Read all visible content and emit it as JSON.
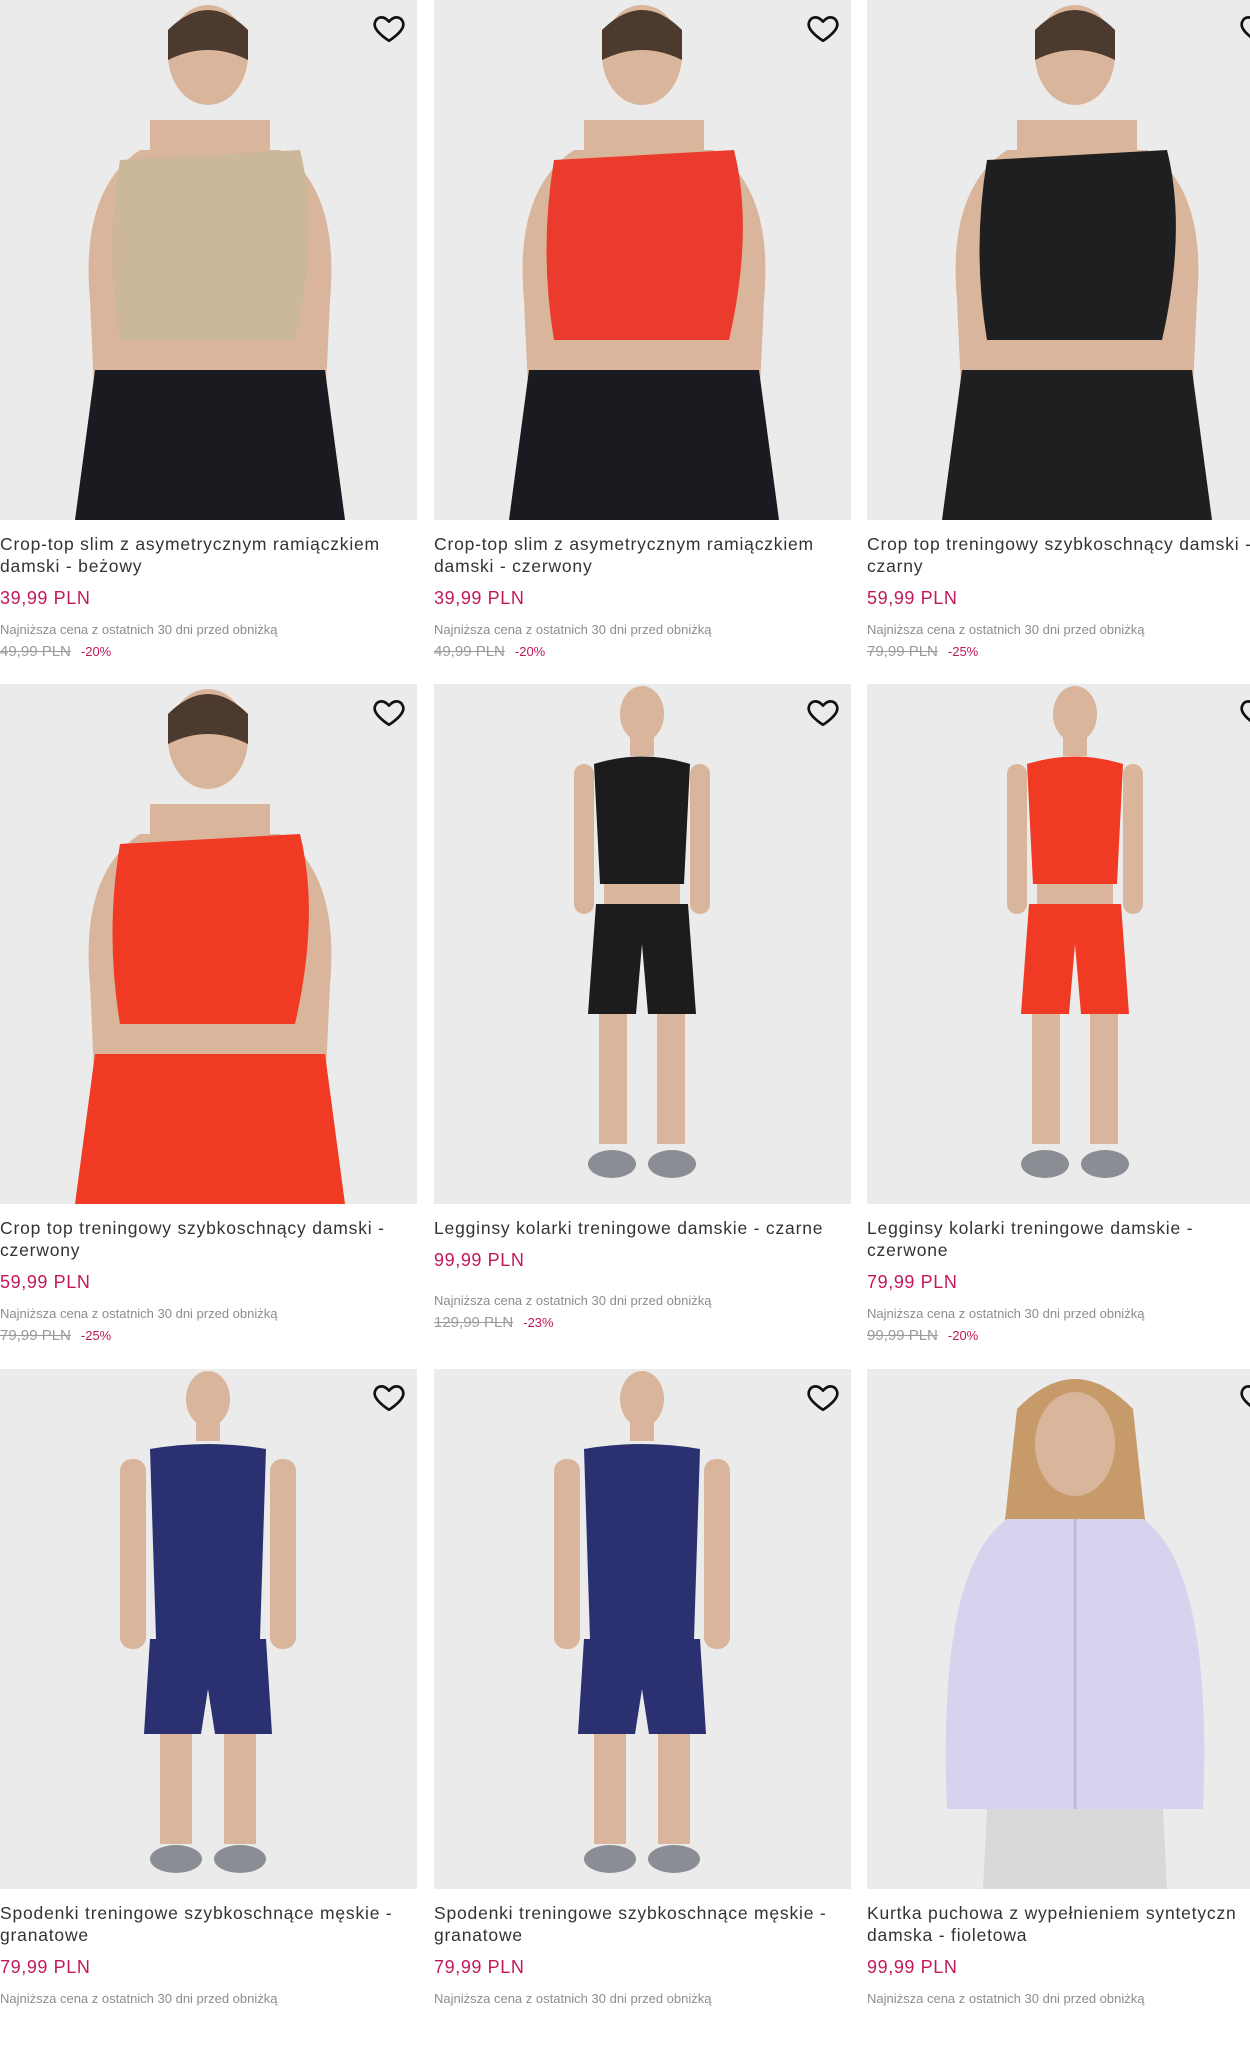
{
  "products": [
    {
      "name": "Crop-top slim z asymetrycznym ramiączkiem\ndamski - beżowy",
      "price": "39,99 PLN",
      "lowest_label": "Najniższa cena z ostatnich 30 dni przed obniżką",
      "old_price": "49,99 PLN",
      "discount": "-20%",
      "garment_color": "#cbb899",
      "bottom_color": "#1a1b20",
      "style": "asym"
    },
    {
      "name": "Crop-top slim z asymetrycznym ramiączkiem\ndamski - czerwony",
      "price": "39,99 PLN",
      "lowest_label": "Najniższa cena z ostatnich 30 dni przed obniżką",
      "old_price": "49,99 PLN",
      "discount": "-20%",
      "garment_color": "#ea3b2c",
      "bottom_color": "#1a1b20",
      "style": "asym"
    },
    {
      "name": "Crop top treningowy szybkoschnący damski -\nczarny",
      "price": "59,99 PLN",
      "lowest_label": "Najniższa cena z ostatnich 30 dni przed obniżką",
      "old_price": "79,99 PLN",
      "discount": "-25%",
      "garment_color": "#1f1f21",
      "bottom_color": "#1f1f21",
      "style": "tank"
    },
    {
      "name": "Crop top treningowy szybkoschnący damski -\nczerwony",
      "price": "59,99 PLN",
      "lowest_label": "Najniższa cena z ostatnich 30 dni przed obniżką",
      "old_price": "79,99 PLN",
      "discount": "-25%",
      "garment_color": "#f03a23",
      "bottom_color": "#f03a23",
      "style": "tank"
    },
    {
      "name": "Legginsy kolarki treningowe damskie - czarne",
      "price": "99,99 PLN",
      "lowest_label": "Najniższa cena z ostatnich 30 dni przed obniżką",
      "old_price": "129,99 PLN",
      "discount": "-23%",
      "garment_color": "#1c1c1e",
      "bottom_color": "#1c1c1e",
      "style": "full"
    },
    {
      "name": "Legginsy kolarki treningowe damskie -\nczerwone",
      "price": "79,99 PLN",
      "lowest_label": "Najniższa cena z ostatnich 30 dni przed obniżką",
      "old_price": "99,99 PLN",
      "discount": "-20%",
      "garment_color": "#f03a23",
      "bottom_color": "#f03a23",
      "style": "full"
    },
    {
      "name": "Spodenki treningowe szybkoschnące męskie -\ngranatowe",
      "price": "79,99 PLN",
      "lowest_label": "Najniższa cena z ostatnich 30 dni przed obniżką",
      "old_price": "",
      "discount": "",
      "garment_color": "#2b3170",
      "bottom_color": "#2b3170",
      "style": "male"
    },
    {
      "name": "Spodenki treningowe szybkoschnące męskie -\ngranatowe",
      "price": "79,99 PLN",
      "lowest_label": "Najniższa cena z ostatnich 30 dni przed obniżką",
      "old_price": "",
      "discount": "",
      "garment_color": "#2b3170",
      "bottom_color": "#2b3170",
      "style": "male"
    },
    {
      "name": "Kurtka puchowa z wypełnieniem syntetyczn\ndamska - fioletowa",
      "price": "99,99 PLN",
      "lowest_label": "Najniższa cena z ostatnich 30 dni przed obniżką",
      "old_price": "",
      "discount": "",
      "garment_color": "#d6d3ee",
      "bottom_color": "#d9d9d9",
      "style": "jacket"
    }
  ]
}
